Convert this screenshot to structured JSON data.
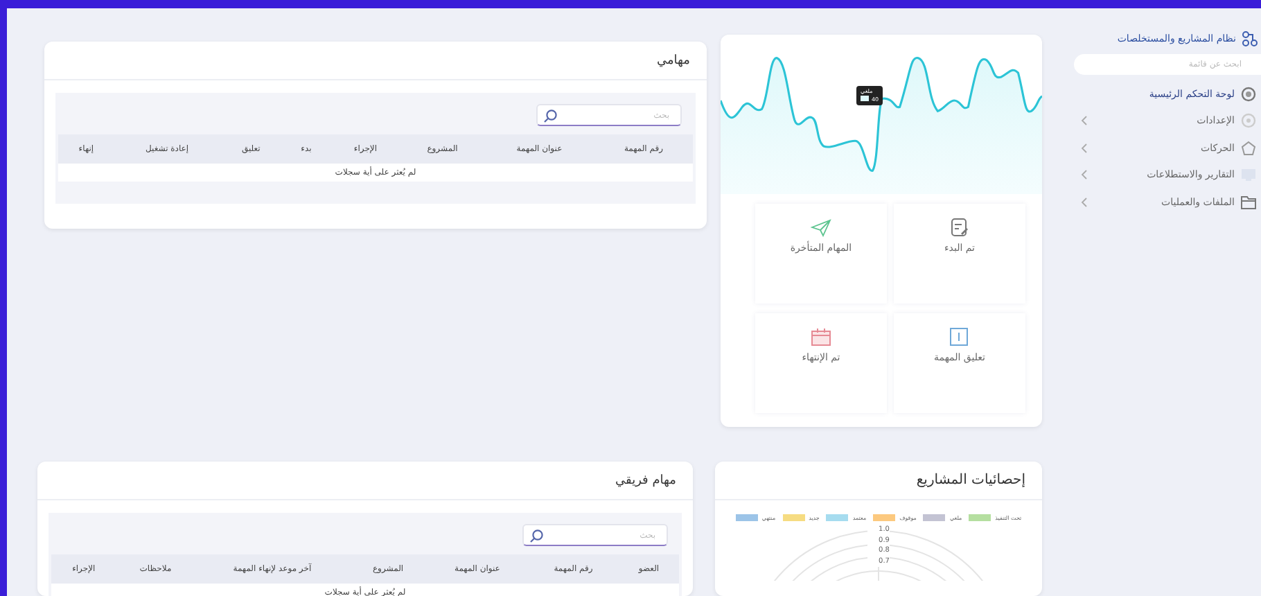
{
  "sidebar": {
    "title": "نظام المشاريع والمستخلصات",
    "search": {
      "placeholder": "ابحث عن قائمة"
    },
    "items": [
      {
        "label": "لوحة التحكم الرئيسية",
        "kind": "dashboard",
        "selected": true,
        "expandable": false
      },
      {
        "label": "الإعدادات",
        "kind": "settings",
        "selected": false,
        "expandable": true
      },
      {
        "label": "الحركات",
        "kind": "movements",
        "selected": false,
        "expandable": true
      },
      {
        "label": "التقارير والاستطلاعات",
        "kind": "reports",
        "selected": false,
        "expandable": true
      },
      {
        "label": "الملفات والعمليات",
        "kind": "files",
        "selected": false,
        "expandable": true
      }
    ]
  },
  "my_tasks": {
    "title": "مهامي",
    "search": {
      "placeholder": "بحث"
    },
    "columns": [
      "رقم المهمة",
      "عنوان المهمة",
      "المشروع",
      "الإجراء",
      "بدء",
      "تعليق",
      "إعادة تشغيل",
      "إنهاء"
    ],
    "empty_message": "لم يُعثر على أية سجلات"
  },
  "activity": {
    "tooltip": {
      "label": "ملغي",
      "value": "40"
    },
    "tiles": [
      {
        "label": "تم البدء",
        "kind": "started"
      },
      {
        "label": "المهام المتأخرة",
        "kind": "late"
      },
      {
        "label": "تعليق المهمة",
        "kind": "suspended"
      },
      {
        "label": "تم الإنتهاء",
        "kind": "finished"
      }
    ]
  },
  "team_tasks": {
    "title": "مهام فريقي",
    "search": {
      "placeholder": "بحث"
    },
    "columns": [
      "العضو",
      "رقم المهمة",
      "عنوان المهمة",
      "المشروع",
      "آخر موعد لإنهاء المهمة",
      "ملاحظات",
      "الإجراء"
    ],
    "empty_message": "لم يُعثر على أية سجلات"
  },
  "project_stats": {
    "title": "إحصائيات المشاريع",
    "legend": [
      {
        "label": "تحت التنفيذ",
        "color": "#b5dfa0"
      },
      {
        "label": "ملغي",
        "color": "#c3c3d3"
      },
      {
        "label": "موقوف",
        "color": "#fcc97f"
      },
      {
        "label": "معتمد",
        "color": "#a6dcef"
      },
      {
        "label": "جديد",
        "color": "#f6dc82"
      },
      {
        "label": "منتهي",
        "color": "#9cc4e8"
      }
    ],
    "radar_ticks": [
      "1.0",
      "0.9",
      "0.8",
      "0.7"
    ]
  }
}
